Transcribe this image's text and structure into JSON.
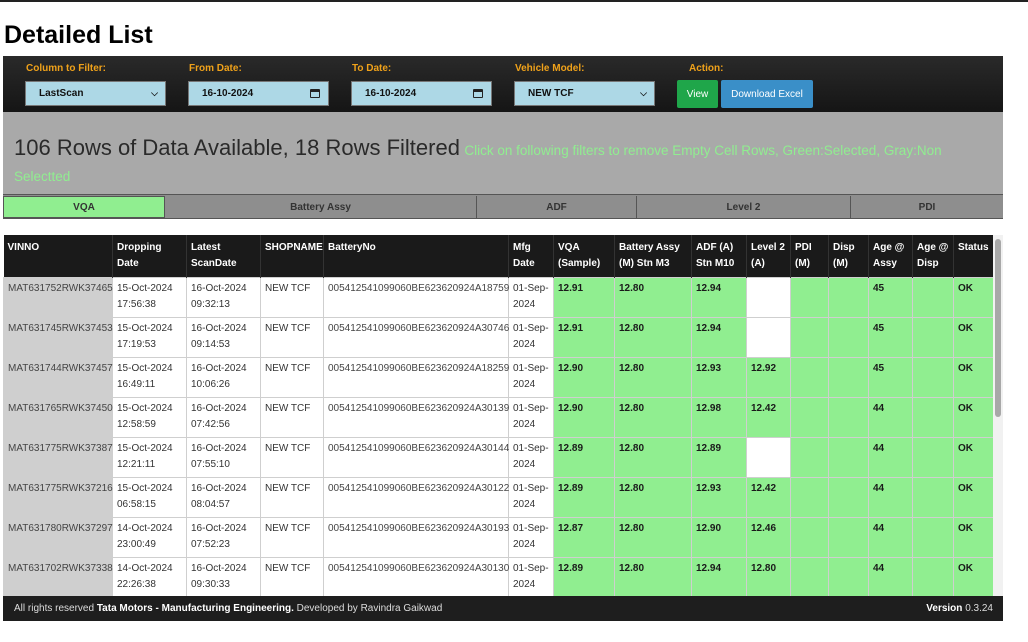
{
  "page": {
    "title": "Detailed List"
  },
  "filters": {
    "column_label": "Column to Filter:",
    "column_value": "LastScan",
    "from_label": "From Date:",
    "from_value": "16-10-2024",
    "to_label": "To Date:",
    "to_value": "16-10-2024",
    "model_label": "Vehicle Model:",
    "model_value": "NEW TCF",
    "action_label": "Action:",
    "view_label": "View",
    "download_label": "Download Excel"
  },
  "summary": {
    "main": "106 Rows of Data Available, 18 Rows Filtered",
    "hint": "Click on following filters to remove Empty Cell Rows, Green:Selected, Gray:Non Selectted"
  },
  "tabs": [
    {
      "label": "VQA",
      "active": true
    },
    {
      "label": "Battery Assy",
      "active": false
    },
    {
      "label": "ADF",
      "active": false
    },
    {
      "label": "Level 2",
      "active": false
    },
    {
      "label": "PDI",
      "active": false
    }
  ],
  "table": {
    "headers": [
      [
        "VINNO"
      ],
      [
        "Dropping",
        "Date"
      ],
      [
        "Latest",
        "ScanDate"
      ],
      [
        "SHOPNAME"
      ],
      [
        "BatteryNo"
      ],
      [
        "Mfg",
        "Date"
      ],
      [
        "VQA",
        "(Sample)"
      ],
      [
        "Battery Assy",
        "(M) Stn M3"
      ],
      [
        "ADF (A)",
        "Stn M10"
      ],
      [
        "Level 2",
        "(A)"
      ],
      [
        "PDI",
        "(M)"
      ],
      [
        "Disp",
        "(M)"
      ],
      [
        "Age @",
        "Assy"
      ],
      [
        "Age @",
        "Disp"
      ],
      [
        "Status"
      ]
    ],
    "rows": [
      {
        "vin": "MAT631752RWK37465",
        "drop_date": "15-Oct-2024",
        "drop_time": "17:56:38",
        "scan_date": "16-Oct-2024",
        "scan_time": "09:32:13",
        "shop": "NEW TCF",
        "battery": "005412541099060BE623620924A18759",
        "mfg_a": "01-Sep-",
        "mfg_b": "2024",
        "vqa": "12.91",
        "batt": "12.80",
        "adf": "12.94",
        "level2": "",
        "pdi": "",
        "disp": "",
        "age_assy": "45",
        "age_disp": "",
        "status": "OK"
      },
      {
        "vin": "MAT631745RWK37453",
        "drop_date": "15-Oct-2024",
        "drop_time": "17:19:53",
        "scan_date": "16-Oct-2024",
        "scan_time": "09:14:53",
        "shop": "NEW TCF",
        "battery": "005412541099060BE623620924A30746",
        "mfg_a": "01-Sep-",
        "mfg_b": "2024",
        "vqa": "12.91",
        "batt": "12.80",
        "adf": "12.94",
        "level2": "",
        "pdi": "",
        "disp": "",
        "age_assy": "45",
        "age_disp": "",
        "status": "OK"
      },
      {
        "vin": "MAT631744RWK37457",
        "drop_date": "15-Oct-2024",
        "drop_time": "16:49:11",
        "scan_date": "16-Oct-2024",
        "scan_time": "10:06:26",
        "shop": "NEW TCF",
        "battery": "005412541099060BE623620924A18259",
        "mfg_a": "01-Sep-",
        "mfg_b": "2024",
        "vqa": "12.90",
        "batt": "12.80",
        "adf": "12.93",
        "level2": "12.92",
        "pdi": "",
        "disp": "",
        "age_assy": "45",
        "age_disp": "",
        "status": "OK"
      },
      {
        "vin": "MAT631765RWK37450",
        "drop_date": "15-Oct-2024",
        "drop_time": "12:58:59",
        "scan_date": "16-Oct-2024",
        "scan_time": "07:42:56",
        "shop": "NEW TCF",
        "battery": "005412541099060BE623620924A30139",
        "mfg_a": "01-Sep-",
        "mfg_b": "2024",
        "vqa": "12.90",
        "batt": "12.80",
        "adf": "12.98",
        "level2": "12.42",
        "pdi": "",
        "disp": "",
        "age_assy": "44",
        "age_disp": "",
        "status": "OK"
      },
      {
        "vin": "MAT631775RWK37387",
        "drop_date": "15-Oct-2024",
        "drop_time": "12:21:11",
        "scan_date": "16-Oct-2024",
        "scan_time": "07:55:10",
        "shop": "NEW TCF",
        "battery": "005412541099060BE623620924A30144",
        "mfg_a": "01-Sep-",
        "mfg_b": "2024",
        "vqa": "12.89",
        "batt": "12.80",
        "adf": "12.89",
        "level2": "",
        "pdi": "",
        "disp": "",
        "age_assy": "44",
        "age_disp": "",
        "status": "OK"
      },
      {
        "vin": "MAT631775RWK37216",
        "drop_date": "15-Oct-2024",
        "drop_time": "06:58:15",
        "scan_date": "16-Oct-2024",
        "scan_time": "08:04:57",
        "shop": "NEW TCF",
        "battery": "005412541099060BE623620924A30122",
        "mfg_a": "01-Sep-",
        "mfg_b": "2024",
        "vqa": "12.89",
        "batt": "12.80",
        "adf": "12.93",
        "level2": "12.42",
        "pdi": "",
        "disp": "",
        "age_assy": "44",
        "age_disp": "",
        "status": "OK"
      },
      {
        "vin": "MAT631780RWK37297",
        "drop_date": "14-Oct-2024",
        "drop_time": "23:00:49",
        "scan_date": "16-Oct-2024",
        "scan_time": "07:52:23",
        "shop": "NEW TCF",
        "battery": "005412541099060BE623620924A30193",
        "mfg_a": "01-Sep-",
        "mfg_b": "2024",
        "vqa": "12.87",
        "batt": "12.80",
        "adf": "12.90",
        "level2": "12.46",
        "pdi": "",
        "disp": "",
        "age_assy": "44",
        "age_disp": "",
        "status": "OK"
      },
      {
        "vin": "MAT631702RWK37338",
        "drop_date": "14-Oct-2024",
        "drop_time": "22:26:38",
        "scan_date": "16-Oct-2024",
        "scan_time": "09:30:33",
        "shop": "NEW TCF",
        "battery": "005412541099060BE623620924A30130",
        "mfg_a": "01-Sep-",
        "mfg_b": "2024",
        "vqa": "12.89",
        "batt": "12.80",
        "adf": "12.94",
        "level2": "12.80",
        "pdi": "",
        "disp": "",
        "age_assy": "44",
        "age_disp": "",
        "status": "OK"
      }
    ]
  },
  "footer": {
    "prefix": "All rights reserved",
    "org": "Tata Motors - Manufacturing Engineering.",
    "developer": "Developed by Ravindra Gaikwad",
    "version_label": "Version",
    "version": "0.3.24"
  }
}
